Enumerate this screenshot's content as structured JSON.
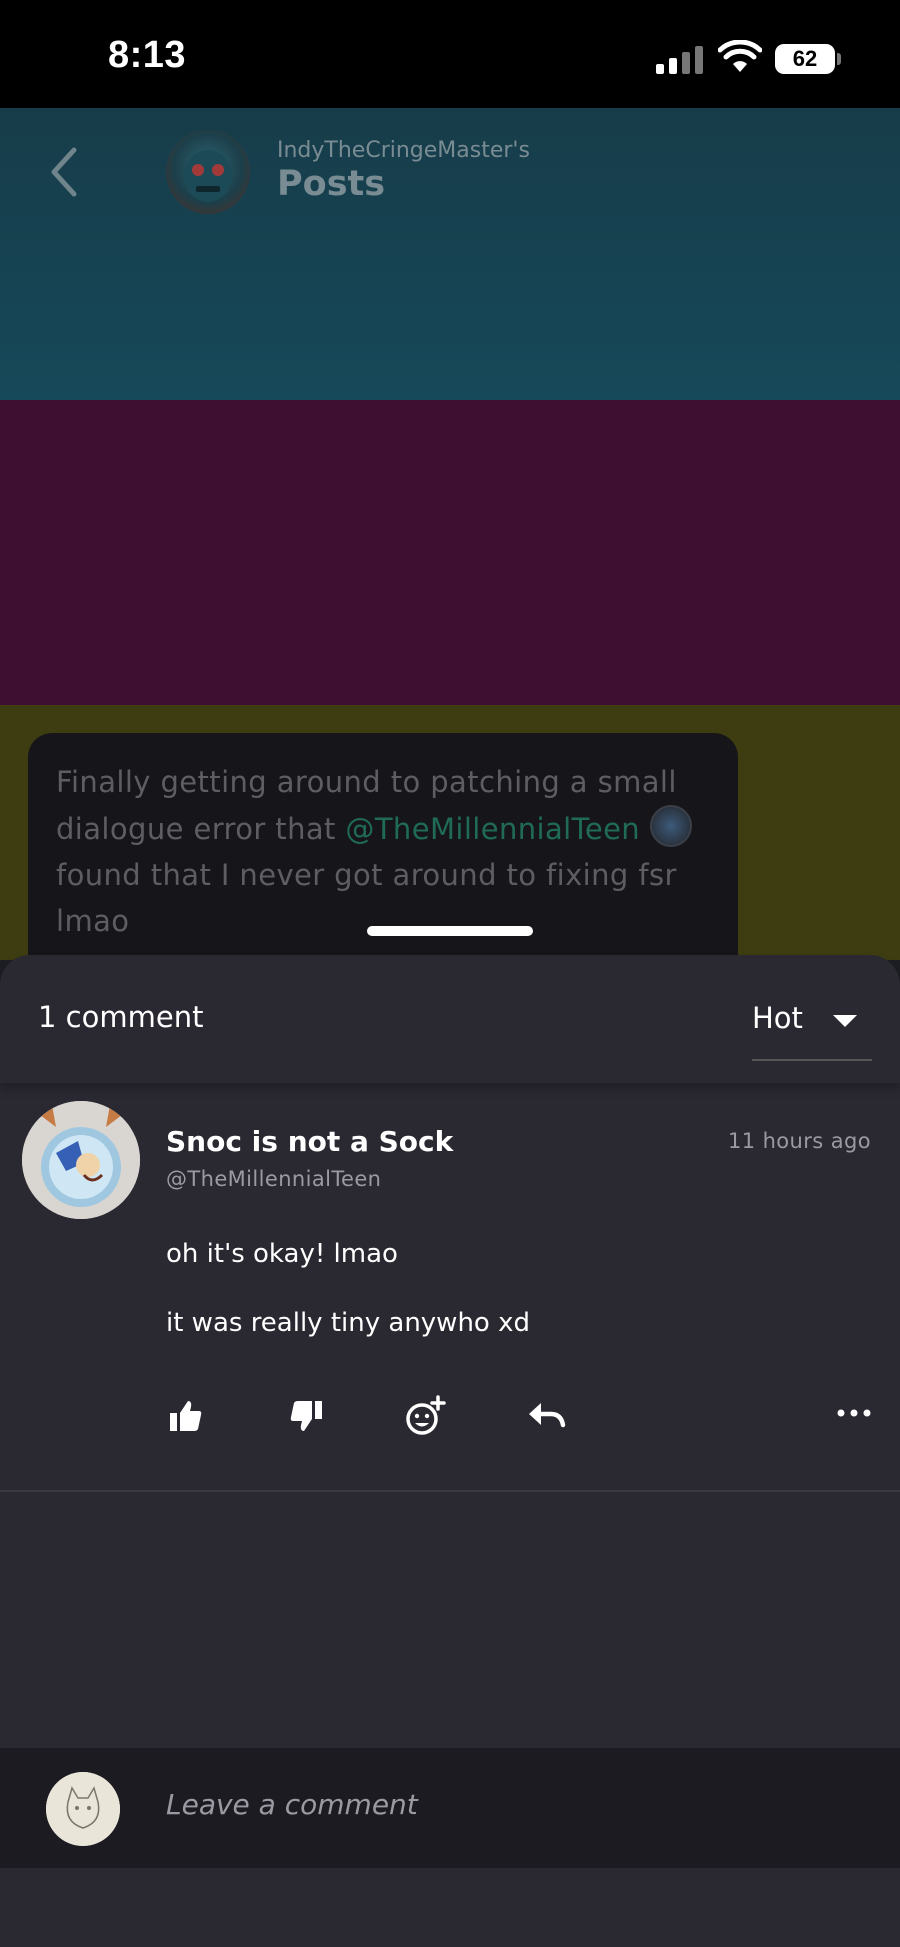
{
  "status_bar": {
    "time": "8:13",
    "battery": "62"
  },
  "header": {
    "subtitle": "IndyTheCringeMaster's",
    "title": "Posts"
  },
  "post": {
    "text_before": "Finally getting around to patching a small dialogue error that ",
    "mention": "@TheMillennialTeen",
    "text_after": " found that I never got around to fixing fsr lmao"
  },
  "comments_sheet": {
    "count_label": "1 comment",
    "sort": "Hot",
    "comments": [
      {
        "author": "Snoc is not a Sock",
        "handle": "@TheMillennialTeen",
        "time": "11 hours ago",
        "lines": [
          "oh it's okay! lmao",
          "it was really tiny anywho xd"
        ]
      }
    ]
  },
  "compose": {
    "placeholder": "Leave a comment"
  },
  "colors": {
    "mention": "#1f6b55",
    "sheet_bg": "#2a2932",
    "band_teal": "#16495a",
    "band_magenta": "#3e0f31",
    "band_olive": "#3e3d11"
  }
}
